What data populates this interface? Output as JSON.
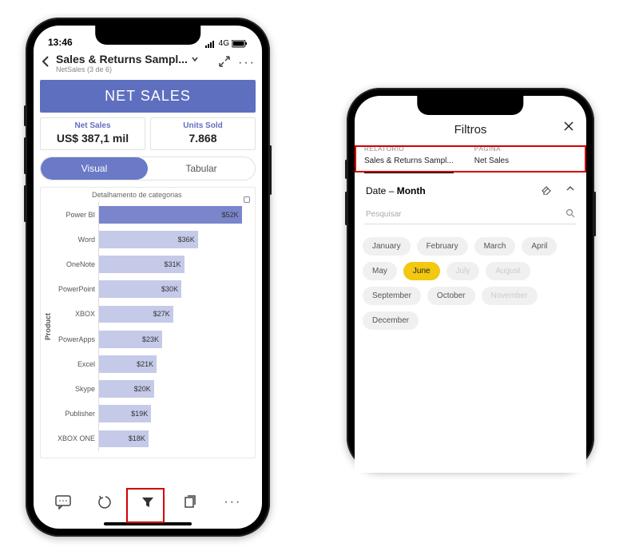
{
  "phone1": {
    "status": {
      "time": "13:46",
      "net": "4G"
    },
    "nav": {
      "title": "Sales & Returns Sampl...",
      "subtitle": "NetSales (3 de 6)"
    },
    "banner": "NET SALES",
    "kpi": [
      {
        "label": "Net Sales",
        "value": "US$ 387,1 mil"
      },
      {
        "label": "Units Sold",
        "value": "7.868"
      }
    ],
    "tabs": {
      "visual": "Visual",
      "tabular": "Tabular",
      "active": 0
    },
    "chart_title": "Detalhamento de categorias",
    "y_axis_label": "Product"
  },
  "chart_data": {
    "type": "bar",
    "orientation": "horizontal",
    "xlabel": "",
    "ylabel": "Product",
    "xlim": [
      0,
      55
    ],
    "categories": [
      "Power BI",
      "Word",
      "OneNote",
      "PowerPoint",
      "XBOX",
      "PowerApps",
      "Excel",
      "Skype",
      "Publisher",
      "XBOX ONE"
    ],
    "values": [
      52,
      36,
      31,
      30,
      27,
      23,
      21,
      20,
      19,
      18
    ],
    "value_labels": [
      "$52K",
      "$36K",
      "$31K",
      "$30K",
      "$27K",
      "$23K",
      "$21K",
      "$20K",
      "$19K",
      "$18K"
    ],
    "highlight_index": 0
  },
  "phone2": {
    "title": "Filtros",
    "tabs": [
      {
        "label": "RELATÓRIO",
        "value": "Sales & Returns Sampl...",
        "active": true
      },
      {
        "label": "PÁGINA",
        "value": "Net Sales",
        "active": false
      }
    ],
    "filter_field": "Date",
    "filter_level": "Month",
    "search_placeholder": "Pesquisar",
    "months": [
      {
        "name": "January",
        "state": ""
      },
      {
        "name": "February",
        "state": ""
      },
      {
        "name": "March",
        "state": ""
      },
      {
        "name": "April",
        "state": ""
      },
      {
        "name": "May",
        "state": ""
      },
      {
        "name": "June",
        "state": "selected"
      },
      {
        "name": "July",
        "state": "disabled"
      },
      {
        "name": "August",
        "state": "disabled"
      },
      {
        "name": "September",
        "state": ""
      },
      {
        "name": "October",
        "state": ""
      },
      {
        "name": "November",
        "state": "disabled"
      },
      {
        "name": "December",
        "state": ""
      }
    ]
  }
}
